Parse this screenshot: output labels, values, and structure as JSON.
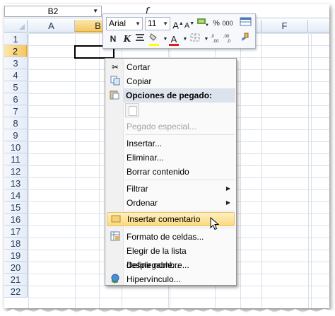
{
  "name_box": {
    "value": "B2"
  },
  "formula_bar": {
    "fx_label": "f"
  },
  "columns": [
    "A",
    "B",
    "C",
    "D",
    "E",
    "F"
  ],
  "rows": [
    "1",
    "2",
    "3",
    "4",
    "5",
    "6",
    "7",
    "8",
    "9",
    "10",
    "11",
    "12",
    "13",
    "14",
    "15",
    "16",
    "17",
    "18",
    "19",
    "20",
    "21",
    "22"
  ],
  "selected_cell": "B2",
  "mini_toolbar": {
    "font_name": "Arial",
    "font_size": "11",
    "grow_font": "A",
    "shrink_font": "A",
    "percent": "%",
    "thousands": "000",
    "bold": "N",
    "italic": "K",
    "font_color_letter": "A",
    "inc_decimal": ",0 ,00",
    "dec_decimal": ",00 ,0",
    "fill_color": "#ffff00",
    "font_color": "#e01b1b"
  },
  "context_menu": {
    "items": [
      {
        "label": "Cortar",
        "icon": "scissors-icon",
        "enabled": true
      },
      {
        "label": "Copiar",
        "icon": "copy-icon",
        "enabled": true
      },
      {
        "label": "Opciones de pegado:",
        "icon": "clipboard-icon",
        "section": true
      },
      {
        "label": "Pegado especial...",
        "enabled": false
      },
      {
        "label": "Insertar...",
        "enabled": true
      },
      {
        "label": "Eliminar...",
        "enabled": true
      },
      {
        "label": "Borrar contenido",
        "enabled": true
      },
      {
        "label": "Filtrar",
        "enabled": true,
        "submenu": true
      },
      {
        "label": "Ordenar",
        "enabled": true,
        "submenu": true
      },
      {
        "label": "Insertar comentario",
        "icon": "comment-icon",
        "enabled": true,
        "hover": true
      },
      {
        "label": "Formato de celdas...",
        "icon": "format-cells-icon",
        "enabled": true
      },
      {
        "label": "Elegir de la lista desplegable...",
        "enabled": true
      },
      {
        "label": "Definir nombre...",
        "enabled": true
      },
      {
        "label": "Hipervínculo...",
        "icon": "hyperlink-icon",
        "enabled": true
      }
    ]
  }
}
